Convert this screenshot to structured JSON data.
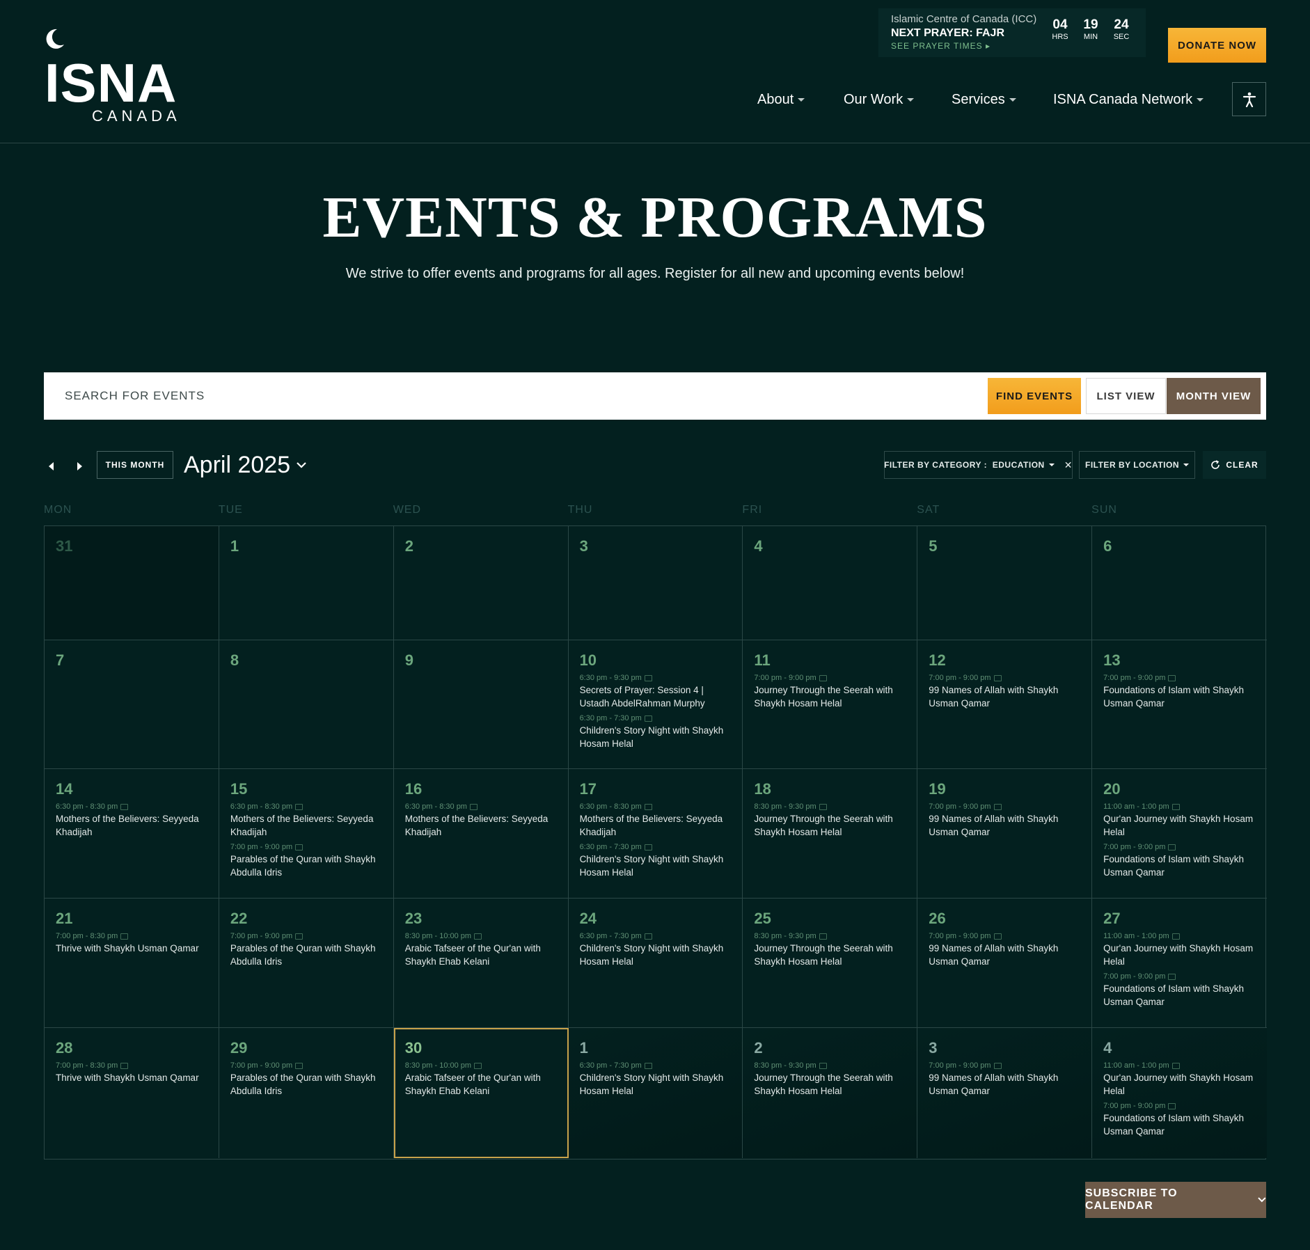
{
  "brand": {
    "logo_word": "ISNA",
    "logo_sub": "CANADA"
  },
  "prayer": {
    "location": "Islamic Centre of Canada (ICC)",
    "next": "NEXT PRAYER: FAJR",
    "see": "SEE PRAYER TIMES",
    "countdown": [
      {
        "num": "04",
        "label": "HRS"
      },
      {
        "num": "19",
        "label": "MIN"
      },
      {
        "num": "24",
        "label": "SEC"
      }
    ]
  },
  "donate_label": "DONATE NOW",
  "nav": [
    {
      "label": "About"
    },
    {
      "label": "Our Work"
    },
    {
      "label": "Services"
    },
    {
      "label": "ISNA Canada Network"
    }
  ],
  "hero": {
    "title": "EVENTS & PROGRAMS",
    "subtitle": "We strive to offer events and programs for all ages. Register for all new and upcoming events below!"
  },
  "search": {
    "placeholder": "SEARCH FOR EVENTS",
    "find_label": "FIND EVENTS",
    "list_label": "LIST VIEW",
    "month_label": "MONTH VIEW"
  },
  "toolbar": {
    "this_month": "THIS MONTH",
    "month_title": "April 2025",
    "filter_category": "FILTER BY CATEGORY :  EDUCATION",
    "filter_location": "FILTER BY LOCATION",
    "clear": "CLEAR"
  },
  "days_of_week": [
    "MON",
    "TUE",
    "WED",
    "THU",
    "FRI",
    "SAT",
    "SUN"
  ],
  "weeks": [
    [
      {
        "day": "31",
        "type": "prev",
        "events": []
      },
      {
        "day": "1",
        "events": []
      },
      {
        "day": "2",
        "events": []
      },
      {
        "day": "3",
        "events": []
      },
      {
        "day": "4",
        "events": []
      },
      {
        "day": "5",
        "events": []
      },
      {
        "day": "6",
        "events": []
      }
    ],
    [
      {
        "day": "7",
        "events": []
      },
      {
        "day": "8",
        "events": []
      },
      {
        "day": "9",
        "events": []
      },
      {
        "day": "10",
        "events": [
          {
            "time": "6:30 pm - 9:30 pm",
            "title": "Secrets of Prayer: Session 4 | Ustadh AbdelRahman Murphy"
          },
          {
            "time": "6:30 pm - 7:30 pm",
            "title": "Children's Story Night with Shaykh Hosam Helal"
          }
        ]
      },
      {
        "day": "11",
        "events": [
          {
            "time": "7:00 pm - 9:00 pm",
            "title": "Journey Through the Seerah with Shaykh Hosam Helal"
          }
        ]
      },
      {
        "day": "12",
        "events": [
          {
            "time": "7:00 pm - 9:00 pm",
            "title": "99 Names of Allah with Shaykh Usman Qamar"
          }
        ]
      },
      {
        "day": "13",
        "events": [
          {
            "time": "7:00 pm - 9:00 pm",
            "title": "Foundations of Islam with Shaykh Usman Qamar"
          }
        ]
      }
    ],
    [
      {
        "day": "14",
        "events": [
          {
            "time": "6:30 pm - 8:30 pm",
            "title": "Mothers of the Believers: Seyyeda Khadijah"
          }
        ]
      },
      {
        "day": "15",
        "events": [
          {
            "time": "6:30 pm - 8:30 pm",
            "title": "Mothers of the Believers: Seyyeda Khadijah"
          },
          {
            "time": "7:00 pm - 9:00 pm",
            "title": "Parables of the Quran with Shaykh Abdulla Idris"
          }
        ]
      },
      {
        "day": "16",
        "events": [
          {
            "time": "6:30 pm - 8:30 pm",
            "title": "Mothers of the Believers: Seyyeda Khadijah"
          }
        ]
      },
      {
        "day": "17",
        "events": [
          {
            "time": "6:30 pm - 8:30 pm",
            "title": "Mothers of the Believers: Seyyeda Khadijah"
          },
          {
            "time": "6:30 pm - 7:30 pm",
            "title": "Children's Story Night with Shaykh Hosam Helal"
          }
        ]
      },
      {
        "day": "18",
        "events": [
          {
            "time": "8:30 pm - 9:30 pm",
            "title": "Journey Through the Seerah with Shaykh Hosam Helal"
          }
        ]
      },
      {
        "day": "19",
        "events": [
          {
            "time": "7:00 pm - 9:00 pm",
            "title": "99 Names of Allah with Shaykh Usman Qamar"
          }
        ]
      },
      {
        "day": "20",
        "events": [
          {
            "time": "11:00 am - 1:00 pm",
            "title": "Qur'an Journey with Shaykh Hosam Helal"
          },
          {
            "time": "7:00 pm - 9:00 pm",
            "title": "Foundations of Islam with Shaykh Usman Qamar"
          }
        ]
      }
    ],
    [
      {
        "day": "21",
        "events": [
          {
            "time": "7:00 pm - 8:30 pm",
            "title": "Thrive with Shaykh Usman Qamar"
          }
        ]
      },
      {
        "day": "22",
        "events": [
          {
            "time": "7:00 pm - 9:00 pm",
            "title": "Parables of the Quran with Shaykh Abdulla Idris"
          }
        ]
      },
      {
        "day": "23",
        "events": [
          {
            "time": "8:30 pm - 10:00 pm",
            "title": "Arabic Tafseer of the Qur'an with Shaykh Ehab Kelani"
          }
        ]
      },
      {
        "day": "24",
        "events": [
          {
            "time": "6:30 pm - 7:30 pm",
            "title": "Children's Story Night with Shaykh Hosam Helal"
          }
        ]
      },
      {
        "day": "25",
        "events": [
          {
            "time": "8:30 pm - 9:30 pm",
            "title": "Journey Through the Seerah with Shaykh Hosam Helal"
          }
        ]
      },
      {
        "day": "26",
        "events": [
          {
            "time": "7:00 pm - 9:00 pm",
            "title": "99 Names of Allah with Shaykh Usman Qamar"
          }
        ]
      },
      {
        "day": "27",
        "events": [
          {
            "time": "11:00 am - 1:00 pm",
            "title": "Qur'an Journey with Shaykh Hosam Helal"
          },
          {
            "time": "7:00 pm - 9:00 pm",
            "title": "Foundations of Islam with Shaykh Usman Qamar"
          }
        ]
      }
    ],
    [
      {
        "day": "28",
        "events": [
          {
            "time": "7:00 pm - 8:30 pm",
            "title": "Thrive with Shaykh Usman Qamar"
          }
        ]
      },
      {
        "day": "29",
        "events": [
          {
            "time": "7:00 pm - 9:00 pm",
            "title": "Parables of the Quran with Shaykh Abdulla Idris"
          }
        ]
      },
      {
        "day": "30",
        "type": "today",
        "events": [
          {
            "time": "8:30 pm - 10:00 pm",
            "title": "Arabic Tafseer of the Qur'an with Shaykh Ehab Kelani"
          }
        ]
      },
      {
        "day": "1",
        "type": "next",
        "events": [
          {
            "time": "6:30 pm - 7:30 pm",
            "title": "Children's Story Night with Shaykh Hosam Helal"
          }
        ]
      },
      {
        "day": "2",
        "type": "next",
        "events": [
          {
            "time": "8:30 pm - 9:30 pm",
            "title": "Journey Through the Seerah with Shaykh Hosam Helal"
          }
        ]
      },
      {
        "day": "3",
        "type": "next",
        "events": [
          {
            "time": "7:00 pm - 9:00 pm",
            "title": "99 Names of Allah with Shaykh Usman Qamar"
          }
        ]
      },
      {
        "day": "4",
        "type": "next",
        "events": [
          {
            "time": "11:00 am - 1:00 pm",
            "title": "Qur'an Journey with Shaykh Hosam Helal"
          },
          {
            "time": "7:00 pm - 9:00 pm",
            "title": "Foundations of Islam with Shaykh Usman Qamar"
          }
        ]
      }
    ]
  ],
  "subscribe_label": "SUBSCRIBE TO CALENDAR",
  "colors": {
    "background": "#03201f",
    "accent_orange": "#f4a52a",
    "brown": "#6d5a49",
    "day_number_green": "#6ca67d",
    "today_outline": "#c8a24b"
  }
}
